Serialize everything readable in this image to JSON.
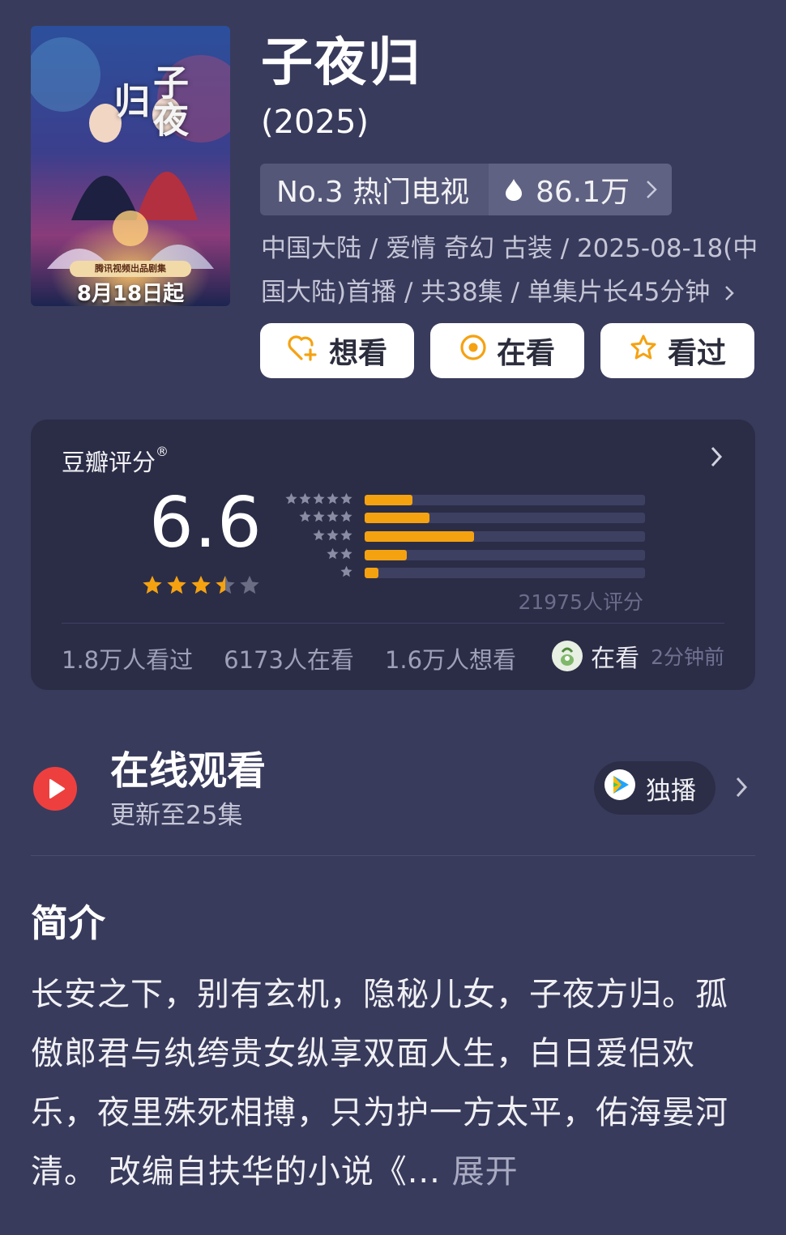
{
  "poster": {
    "title_art": "子夜归",
    "badge": "腾讯视频出品剧集",
    "date": "8月18日起"
  },
  "header": {
    "title": "子夜归",
    "year": "(2025)",
    "rank": "No.3 热门电视",
    "heat": "86.1万",
    "meta": "中国大陆 / 爱情 奇幻 古装 / 2025-08-18(中国大陆)首播 / 共38集 / 单集片长45分钟"
  },
  "actions": {
    "want": "想看",
    "watching": "在看",
    "watched": "看过"
  },
  "rating": {
    "label": "豆瓣评分",
    "reg": "®",
    "score": "6.6",
    "stars": 3.5,
    "distribution": [
      {
        "stars": 5,
        "fraction": 0.17
      },
      {
        "stars": 4,
        "fraction": 0.23
      },
      {
        "stars": 3,
        "fraction": 0.39
      },
      {
        "stars": 2,
        "fraction": 0.15
      },
      {
        "stars": 1,
        "fraction": 0.05
      }
    ],
    "count": "21975人评分",
    "watched": "1.8万人看过",
    "watching": "6173人在看",
    "want": "1.6万人想看",
    "friend_status": "在看",
    "friend_time": "2分钟前"
  },
  "online": {
    "title": "在线观看",
    "subtitle": "更新至25集",
    "exclusive": "独播"
  },
  "intro": {
    "heading": "简介",
    "text": "长安之下，别有玄机，隐秘儿女，子夜方归。孤傲郎君与纨绔贵女纵享双面人生，白日爱侣欢乐，夜里殊死相搏，只为护一方太平，佑海晏河清。 改编自扶华的小说《...",
    "more": "展开"
  },
  "colors": {
    "background": "#393b5c",
    "card": "#2b2d47",
    "accent": "#f5a211",
    "play_red": "#ee3f3f"
  }
}
